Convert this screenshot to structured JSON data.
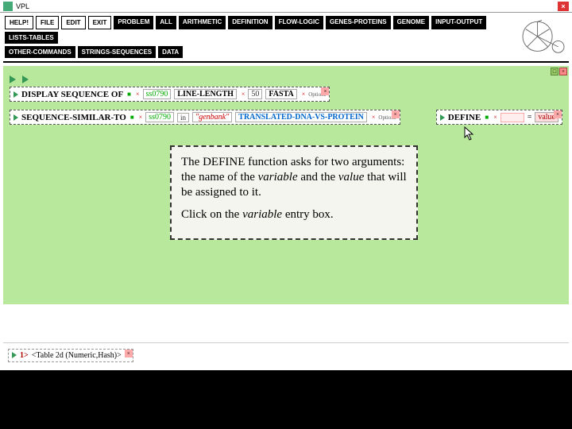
{
  "titlebar": {
    "title": "VPL"
  },
  "toolbar": {
    "row1": [
      {
        "label": "HELP!",
        "style": "white"
      },
      {
        "label": "FILE",
        "style": "white"
      },
      {
        "label": "EDIT",
        "style": "white"
      },
      {
        "label": "EXIT",
        "style": "white"
      },
      {
        "label": "PROBLEM",
        "style": "black"
      },
      {
        "label": "ALL",
        "style": "black"
      },
      {
        "label": "ARITHMETIC",
        "style": "black"
      },
      {
        "label": "DEFINITION",
        "style": "black"
      },
      {
        "label": "FLOW-LOGIC",
        "style": "black"
      },
      {
        "label": "GENES-PROTEINS",
        "style": "black"
      },
      {
        "label": "GENOME",
        "style": "black"
      },
      {
        "label": "INPUT-OUTPUT",
        "style": "black"
      },
      {
        "label": "LISTS-TABLES",
        "style": "black"
      }
    ],
    "row2": [
      {
        "label": "OTHER-COMMANDS",
        "style": "black"
      },
      {
        "label": "STRINGS-SEQUENCES",
        "style": "black"
      },
      {
        "label": "DATA",
        "style": "black"
      }
    ]
  },
  "workspace": {
    "expr1": {
      "func": "DISPLAY SEQUENCE OF",
      "arg1": "ss0790",
      "kw1": "LINE-LENGTH",
      "arg2": "50",
      "kw2": "FASTA",
      "trail": "Options"
    },
    "expr2": {
      "func": "SEQUENCE-SIMILAR-TO",
      "arg1": "ss0790",
      "in": "in",
      "arg2": "\"genbank\"",
      "kw1": "TRANSLATED-DNA-VS-PROTEIN",
      "trail": "Options"
    },
    "define": {
      "label": "DEFINE",
      "eq": "=",
      "value": "value"
    }
  },
  "tooltip": {
    "p1a": "The DEFINE function asks for two arguments: the name of the ",
    "p1b": "variable",
    "p1c": " and the ",
    "p1d": "value",
    "p1e": " that will be assigned to it.",
    "p2a": "Click on the ",
    "p2b": "variable",
    "p2c": " entry box."
  },
  "result": {
    "prefix": "1>",
    "text": "<Table 2d (Numeric,Hash)>"
  }
}
